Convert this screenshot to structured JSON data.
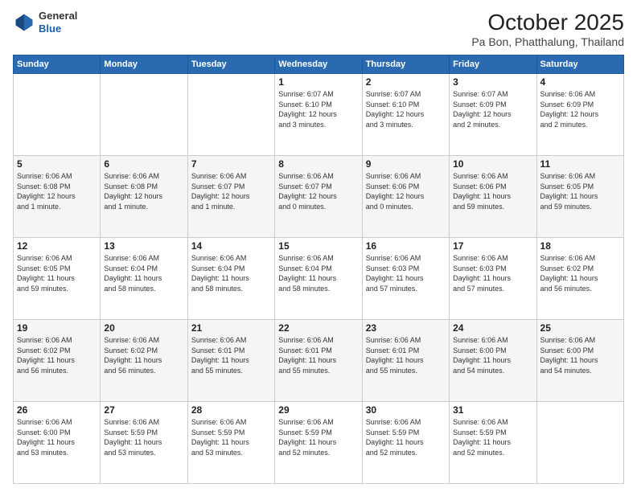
{
  "header": {
    "logo_line1": "General",
    "logo_line2": "Blue",
    "title": "October 2025",
    "subtitle": "Pa Bon, Phatthalung, Thailand"
  },
  "weekdays": [
    "Sunday",
    "Monday",
    "Tuesday",
    "Wednesday",
    "Thursday",
    "Friday",
    "Saturday"
  ],
  "weeks": [
    [
      {
        "day": "",
        "info": ""
      },
      {
        "day": "",
        "info": ""
      },
      {
        "day": "",
        "info": ""
      },
      {
        "day": "1",
        "info": "Sunrise: 6:07 AM\nSunset: 6:10 PM\nDaylight: 12 hours\nand 3 minutes."
      },
      {
        "day": "2",
        "info": "Sunrise: 6:07 AM\nSunset: 6:10 PM\nDaylight: 12 hours\nand 3 minutes."
      },
      {
        "day": "3",
        "info": "Sunrise: 6:07 AM\nSunset: 6:09 PM\nDaylight: 12 hours\nand 2 minutes."
      },
      {
        "day": "4",
        "info": "Sunrise: 6:06 AM\nSunset: 6:09 PM\nDaylight: 12 hours\nand 2 minutes."
      }
    ],
    [
      {
        "day": "5",
        "info": "Sunrise: 6:06 AM\nSunset: 6:08 PM\nDaylight: 12 hours\nand 1 minute."
      },
      {
        "day": "6",
        "info": "Sunrise: 6:06 AM\nSunset: 6:08 PM\nDaylight: 12 hours\nand 1 minute."
      },
      {
        "day": "7",
        "info": "Sunrise: 6:06 AM\nSunset: 6:07 PM\nDaylight: 12 hours\nand 1 minute."
      },
      {
        "day": "8",
        "info": "Sunrise: 6:06 AM\nSunset: 6:07 PM\nDaylight: 12 hours\nand 0 minutes."
      },
      {
        "day": "9",
        "info": "Sunrise: 6:06 AM\nSunset: 6:06 PM\nDaylight: 12 hours\nand 0 minutes."
      },
      {
        "day": "10",
        "info": "Sunrise: 6:06 AM\nSunset: 6:06 PM\nDaylight: 11 hours\nand 59 minutes."
      },
      {
        "day": "11",
        "info": "Sunrise: 6:06 AM\nSunset: 6:05 PM\nDaylight: 11 hours\nand 59 minutes."
      }
    ],
    [
      {
        "day": "12",
        "info": "Sunrise: 6:06 AM\nSunset: 6:05 PM\nDaylight: 11 hours\nand 59 minutes."
      },
      {
        "day": "13",
        "info": "Sunrise: 6:06 AM\nSunset: 6:04 PM\nDaylight: 11 hours\nand 58 minutes."
      },
      {
        "day": "14",
        "info": "Sunrise: 6:06 AM\nSunset: 6:04 PM\nDaylight: 11 hours\nand 58 minutes."
      },
      {
        "day": "15",
        "info": "Sunrise: 6:06 AM\nSunset: 6:04 PM\nDaylight: 11 hours\nand 58 minutes."
      },
      {
        "day": "16",
        "info": "Sunrise: 6:06 AM\nSunset: 6:03 PM\nDaylight: 11 hours\nand 57 minutes."
      },
      {
        "day": "17",
        "info": "Sunrise: 6:06 AM\nSunset: 6:03 PM\nDaylight: 11 hours\nand 57 minutes."
      },
      {
        "day": "18",
        "info": "Sunrise: 6:06 AM\nSunset: 6:02 PM\nDaylight: 11 hours\nand 56 minutes."
      }
    ],
    [
      {
        "day": "19",
        "info": "Sunrise: 6:06 AM\nSunset: 6:02 PM\nDaylight: 11 hours\nand 56 minutes."
      },
      {
        "day": "20",
        "info": "Sunrise: 6:06 AM\nSunset: 6:02 PM\nDaylight: 11 hours\nand 56 minutes."
      },
      {
        "day": "21",
        "info": "Sunrise: 6:06 AM\nSunset: 6:01 PM\nDaylight: 11 hours\nand 55 minutes."
      },
      {
        "day": "22",
        "info": "Sunrise: 6:06 AM\nSunset: 6:01 PM\nDaylight: 11 hours\nand 55 minutes."
      },
      {
        "day": "23",
        "info": "Sunrise: 6:06 AM\nSunset: 6:01 PM\nDaylight: 11 hours\nand 55 minutes."
      },
      {
        "day": "24",
        "info": "Sunrise: 6:06 AM\nSunset: 6:00 PM\nDaylight: 11 hours\nand 54 minutes."
      },
      {
        "day": "25",
        "info": "Sunrise: 6:06 AM\nSunset: 6:00 PM\nDaylight: 11 hours\nand 54 minutes."
      }
    ],
    [
      {
        "day": "26",
        "info": "Sunrise: 6:06 AM\nSunset: 6:00 PM\nDaylight: 11 hours\nand 53 minutes."
      },
      {
        "day": "27",
        "info": "Sunrise: 6:06 AM\nSunset: 5:59 PM\nDaylight: 11 hours\nand 53 minutes."
      },
      {
        "day": "28",
        "info": "Sunrise: 6:06 AM\nSunset: 5:59 PM\nDaylight: 11 hours\nand 53 minutes."
      },
      {
        "day": "29",
        "info": "Sunrise: 6:06 AM\nSunset: 5:59 PM\nDaylight: 11 hours\nand 52 minutes."
      },
      {
        "day": "30",
        "info": "Sunrise: 6:06 AM\nSunset: 5:59 PM\nDaylight: 11 hours\nand 52 minutes."
      },
      {
        "day": "31",
        "info": "Sunrise: 6:06 AM\nSunset: 5:59 PM\nDaylight: 11 hours\nand 52 minutes."
      },
      {
        "day": "",
        "info": ""
      }
    ]
  ]
}
